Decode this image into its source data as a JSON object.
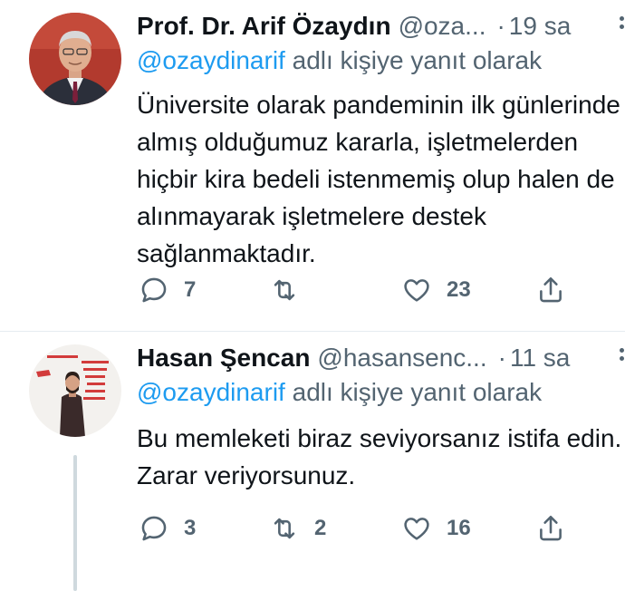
{
  "tweets": [
    {
      "author_name": "Prof. Dr. Arif Özaydın",
      "handle": "@oza...",
      "separator": "·",
      "time": "19 sa",
      "reply_mention": "@ozaydinarif",
      "reply_suffix": " adlı kişiye yanıt olarak",
      "text": "Üniversite olarak pandeminin ilk günlerinde almış olduğumuz kararla, işletmelerden hiçbir kira bedeli istenmemiş olup halen de alınmayarak işletmelere destek sağlanmaktadır.",
      "reply_count": "7",
      "retweet_count": "",
      "like_count": "23"
    },
    {
      "author_name": "Hasan Şencan",
      "handle": "@hasansenc...",
      "separator": "·",
      "time": "11 sa",
      "reply_mention": "@ozaydinarif",
      "reply_suffix": " adlı kişiye yanıt olarak",
      "text": "Bu memleketi biraz seviyorsanız istifa edin. Zarar veriyorsunuz.",
      "reply_count": "3",
      "retweet_count": "2",
      "like_count": "16"
    }
  ],
  "icons": {
    "reply": "speech-bubble",
    "retweet": "retweet-arrows",
    "like": "heart-outline",
    "share": "upload-arrow",
    "more": "vertical-dots"
  },
  "colors": {
    "text": "#0f1419",
    "secondary": "#536471",
    "link": "#1d9bf0",
    "divider": "#e6ecf0"
  }
}
